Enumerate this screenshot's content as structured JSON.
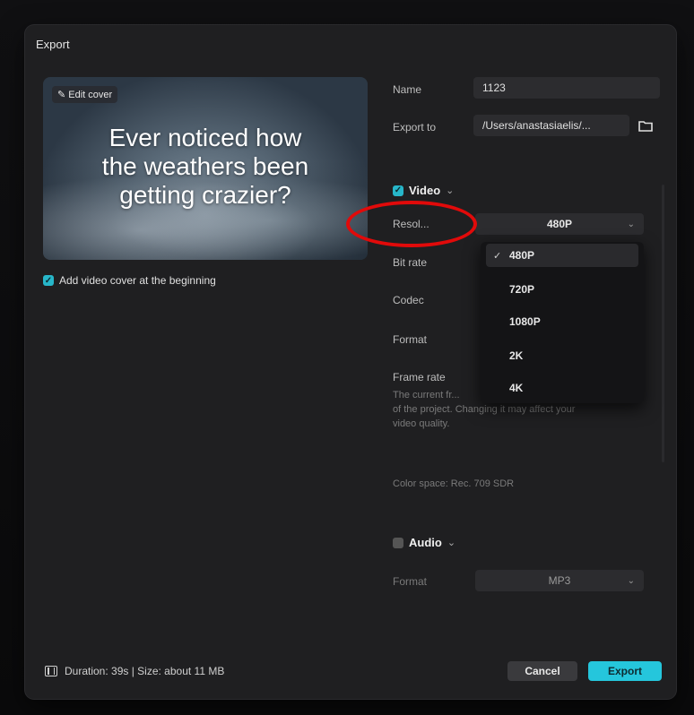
{
  "dialog": {
    "title": "Export"
  },
  "preview": {
    "edit_cover_label": "Edit cover",
    "overlay_text_lines": [
      "Ever noticed how",
      "the weathers been",
      "getting crazier?"
    ],
    "add_cover_label": "Add video cover at the beginning",
    "add_cover_checked": true
  },
  "fields": {
    "name_label": "Name",
    "name_value": "1123",
    "export_to_label": "Export to",
    "export_to_value": "/Users/anastasiaelis/..."
  },
  "video": {
    "section_label": "Video",
    "checked": true,
    "resolution_label": "Resol...",
    "resolution_value": "480P",
    "bitrate_label": "Bit rate",
    "codec_label": "Codec",
    "format_label": "Format",
    "framerate_label": "Frame rate",
    "framerate_note_line1": "The current fr...",
    "framerate_note_line2": "of the project. Changing it may affect your",
    "framerate_note_line3": "video quality.",
    "color_space": "Color space: Rec. 709 SDR",
    "resolution_options": [
      "480P",
      "720P",
      "1080P",
      "2K",
      "4K"
    ],
    "selected_option_index": 0
  },
  "audio": {
    "section_label": "Audio",
    "checked": false,
    "format_label": "Format",
    "format_value": "MP3"
  },
  "footer": {
    "info": "Duration: 39s | Size: about 11 MB",
    "cancel_label": "Cancel",
    "export_label": "Export"
  },
  "colors": {
    "accent": "#25c6dc",
    "annotation_ring": "#e10a0a",
    "dialog_bg": "#1f1f21"
  }
}
